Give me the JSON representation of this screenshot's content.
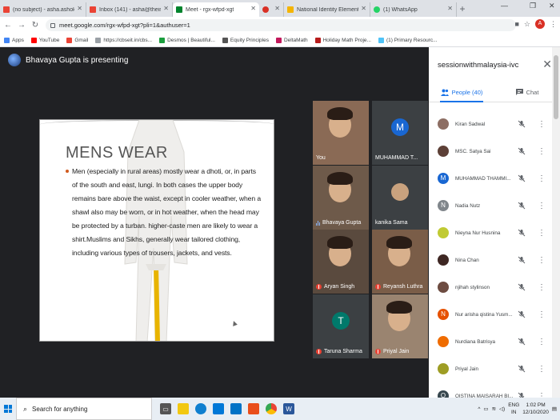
{
  "browser": {
    "tabs": [
      {
        "label": "(no subject) - asha.ashok03@gm",
        "fav_color": "#ea4335",
        "fav": "M"
      },
      {
        "label": "Inbox (141) - asha@theindiansch",
        "fav_color": "#ea4335",
        "fav": "M"
      },
      {
        "label": "Meet - rgx-wfpd-xgt",
        "fav_color": "#00832d",
        "active": true
      },
      {
        "label": "",
        "fav_color": "#d93025"
      },
      {
        "label": "National Identity Elements - Nati",
        "fav_color": "#f4b400"
      },
      {
        "label": "(1) WhatsApp",
        "fav_color": "#25d366"
      }
    ],
    "new_tab": "+",
    "url": "meet.google.com/rgx-wfpd-xgt?pli=1&authuser=1",
    "avatar_letter": "A",
    "bookmarks": [
      {
        "label": "Apps",
        "color": "#4285f4"
      },
      {
        "label": "YouTube",
        "color": "#ff0000"
      },
      {
        "label": "Gmail",
        "color": "#ea4335"
      },
      {
        "label": "https://cbseit.in/cbs...",
        "color": "#9aa0a6"
      },
      {
        "label": "Desmos | Beautiful...",
        "color": "#1b9e3e"
      },
      {
        "label": "Equity Principles",
        "color": "#555555"
      },
      {
        "label": "DeltaMath",
        "color": "#c2185b"
      },
      {
        "label": "Holiday Math Proje...",
        "color": "#b71c1c"
      },
      {
        "label": "(1) Primary Resourc...",
        "color": "#4fc3f7"
      }
    ]
  },
  "meet": {
    "presenter_text": "Bhavaya Gupta is presenting",
    "slide": {
      "title": "MENS WEAR",
      "body": "Men (especially in rural areas) mostly wear a dhoti, or, in parts of the south and east, lungi. In both cases the upper body remains bare above the waist, except in cooler weather, when a shawl also may be worn, or in hot weather, when the head may be protected by a turban. higher-caste men are likely to wear a shirt.Muslims and Sikhs, generally wear tailored clothing, including various types of trousers, jackets, and vests."
    },
    "tiles": [
      {
        "name": "You",
        "type": "video"
      },
      {
        "name": "MUHAMMAD T...",
        "type": "letter",
        "letter": "M",
        "color": "#1967d2"
      },
      {
        "name": "Bhavaya Gupta",
        "type": "video",
        "speaking": true
      },
      {
        "name": "kanika Sama",
        "type": "photo"
      },
      {
        "name": "Aryan Singh",
        "type": "video"
      },
      {
        "name": "Reyansh Luthra",
        "type": "video"
      },
      {
        "name": "Taruna Sharma",
        "type": "letter",
        "letter": "T",
        "color": "#00796b"
      },
      {
        "name": "Priyal Jain",
        "type": "video"
      }
    ]
  },
  "panel": {
    "title": "sessionwithmalaysia-ivc",
    "tab_people": "People (40)",
    "tab_chat": "Chat",
    "participants": [
      {
        "name": "Kiran Sadwal",
        "avatar": "photo",
        "color": "#8d6e63"
      },
      {
        "name": "MSC. Satya Sai",
        "avatar": "photo",
        "color": "#5d4037"
      },
      {
        "name": "MUHAMMAD THAMMI...",
        "avatar": "letter",
        "letter": "M",
        "color": "#1967d2"
      },
      {
        "name": "Nadia Nutz",
        "avatar": "letter",
        "letter": "N",
        "color": "#80868b"
      },
      {
        "name": "Nieyna Nur Husnina",
        "avatar": "photo",
        "color": "#c0ca33"
      },
      {
        "name": "Nina Chan",
        "avatar": "photo",
        "color": "#3e2723"
      },
      {
        "name": "njihah stylinson",
        "avatar": "photo",
        "color": "#6d4c41"
      },
      {
        "name": "Nur arisha qistina Yusm...",
        "avatar": "letter",
        "letter": "N",
        "color": "#e65100"
      },
      {
        "name": "Nurdiana Batrisya",
        "avatar": "photo",
        "color": "#ef6c00"
      },
      {
        "name": "Priyal Jain",
        "avatar": "photo",
        "color": "#9e9d24"
      },
      {
        "name": "QISTINA MAISARAH BI...",
        "avatar": "letter",
        "letter": "Q",
        "color": "#37474f"
      }
    ]
  },
  "taskbar": {
    "search_placeholder": "Search for anything",
    "lang_top": "ENG",
    "lang_bottom": "IN",
    "time": "1:02 PM",
    "date": "12/10/2020"
  }
}
